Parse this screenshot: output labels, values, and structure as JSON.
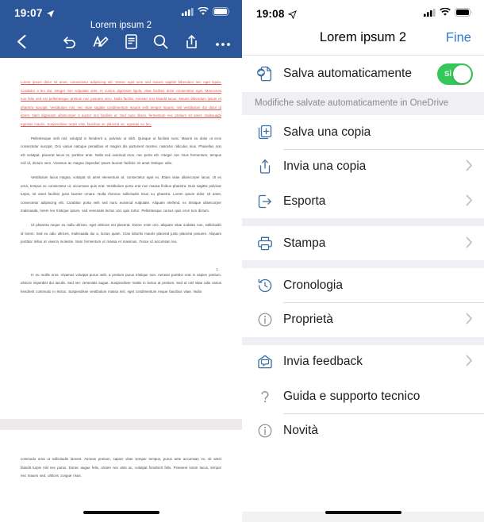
{
  "left_phone": {
    "status": {
      "time": "19:07",
      "location_icon": "location-arrow-icon",
      "cellular_icon": "cellular-bars-icon",
      "wifi_icon": "wifi-icon",
      "battery_icon": "battery-icon"
    },
    "document_title": "Lorem ipsum 2",
    "toolbar": {
      "back_icon": "chevron-left-icon",
      "undo_icon": "undo-arrow-icon",
      "format_icon": "format-text-pen-icon",
      "ribbon_icon": "ribbon-document-icon",
      "search_icon": "search-icon",
      "share_icon": "share-icon",
      "more_icon": "more-ellipsis-icon"
    },
    "document": {
      "paragraph_spellcheck": "Lorem ipsum dolor sit amet, consectetur adipiscing elit. Donec eget sem sed mauris sagittis bibendum nec eget ligula. Curabitur a leo dui. Integer non vulputate ante. In cursus dignissim ligula, vitae facilisis dolor consectetur eget. Maecenas non felis sed est pellentesque pretium nec posuere arcu. Nulla facilisi. Aenean non blandit lacus. Mauris bibendum ipsum et pharetra suscipit. Vestibulum nisl, nec vitae sagittis condimentum mauris velit tempor mauris, nisl vestibulum dui dolor id lorem. Nam dignissim ullamcorper a auctor orci facilisis ut. Sed nunc libero, fermentum nec pretium sit amet, malesuada egestas mauris. Suspendisse turpis erat, faucibus ac placerat ac, egestas eu leo.",
      "paragraph_2": "Pellentesque velit nisl, volutpat in hendrerit a, pulvinar ut nibh. Quisque ut facilisis nunc. Mauris eu dolor ut eros consectetur suscipit. Orci varius natoque penatibus et magnis dis parturient montes, nascetur ridiculus mus. Phasellus non elit volutpat, placerat lacus et, porttitor ante. Nulla sed euismod eros, nec porta elit. Integer nec risus fermentum, tempus nisl id, dictum sem. Vivamus ac magna imperdiet ipsum laoreet facilisis sit amet tristique odio.",
      "paragraph_3": "Vestibulum lacus magna, volutpat sit amet elementum at, consectetur eget ex. Etiam vitae ullamcorper lacus. Ut ex urna, tempus ac consectetur ut, accumsan quis erat. Vestibulum porta erat non massa finibus pharetra. Duis sagittis pulvinar turpis, sit amet facilisis justo laoreet ornare. Nulla rhoncus sollicitudin risus eu pharetra. Lorem ipsum dolor sit amet, consectetur adipiscing elit. Curabitur porta velit sed nunc euismod vulputate. Aliquam eleifend, ex tristique ullamcorper malesuada, lorem leo tristique ipsum, sed venenatis lectus orci quis tortor. Pellentesque cursus quis eros non dictum.",
      "paragraph_4": "Ut pharetra neque eu nulla ultrices, eget ultricies est placerat. Donec enim orci, aliquam vitae sodales non, sollicitudin id lorem. Sed eu odio ultrices, malesuada dui a, luctus quam. Cras lobortis mauris placerat justo placerat posuere. Aliquam porttitor tellus at viverra molestie. Nam fermentum ut massa et maximus. Fusce id accumsan leo.",
      "page_number": "1",
      "paragraph_5": "In eu mollis eros. Vivamus volutpat purus velit, a pretium purus tristique non. Aenean porttitor erat in sapien pretium, ultrices imperdiet dui iaculis. Sed nec venenatis augue. Suspendisse mattis in lectus at pretium. Sed ut nisl vitae odio varius hendrerit commodo in lectus. Suspendisse vestibulum massa nisl, eget condimentum neque faucibus vitae. Nulla",
      "page2_paragraph": "commodo urna ut sollicitudin laoreet. Aenean pretium, sapien vitae semper tempus, purus ante accumsan ex, sit amet blandit turpis nisl nec purus. Donec augue felis, ornare nec ante ac, volutpat hendrerit felis. Praesent lorem lacus, tempor nec mauris sed, ultrices congue risus."
    },
    "home_indicator": "home-indicator"
  },
  "right_phone": {
    "status": {
      "time": "19:08",
      "location_icon": "location-arrow-icon",
      "cellular_icon": "cellular-bars-icon",
      "wifi_icon": "wifi-icon",
      "battery_icon": "battery-icon"
    },
    "nav": {
      "title": "Lorem ipsum 2",
      "action_label": "Fine"
    },
    "autosave": {
      "label": "Salva automaticamente",
      "icon": "autosave-sync-document-icon",
      "toggle_value": "SÌ",
      "toggle_on": true,
      "toggle_color": "#34c759"
    },
    "note": "Modifiche salvate automaticamente in OneDrive",
    "menu_sections": [
      {
        "items": [
          {
            "label": "Salva una copia",
            "icon": "save-copy-plus-icon",
            "chevron": false
          },
          {
            "label": "Invia una copia",
            "icon": "share-upload-icon",
            "chevron": true
          },
          {
            "label": "Esporta",
            "icon": "export-arrow-icon",
            "chevron": true
          }
        ]
      },
      {
        "items": [
          {
            "label": "Stampa",
            "icon": "printer-icon",
            "chevron": true
          }
        ]
      },
      {
        "items": [
          {
            "label": "Cronologia",
            "icon": "history-clock-icon",
            "chevron": false
          },
          {
            "label": "Proprietà",
            "icon": "info-circle-icon",
            "chevron": true
          }
        ]
      },
      {
        "items": [
          {
            "label": "Invia feedback",
            "icon": "feedback-envelope-icon",
            "chevron": true
          },
          {
            "label": "Guida e supporto tecnico",
            "icon": "question-mark-icon",
            "chevron": false
          },
          {
            "label": "Novità",
            "icon": "info-circle-icon",
            "chevron": false
          }
        ]
      }
    ],
    "accent_color": "#2f7bd0",
    "home_indicator": "home-indicator"
  }
}
